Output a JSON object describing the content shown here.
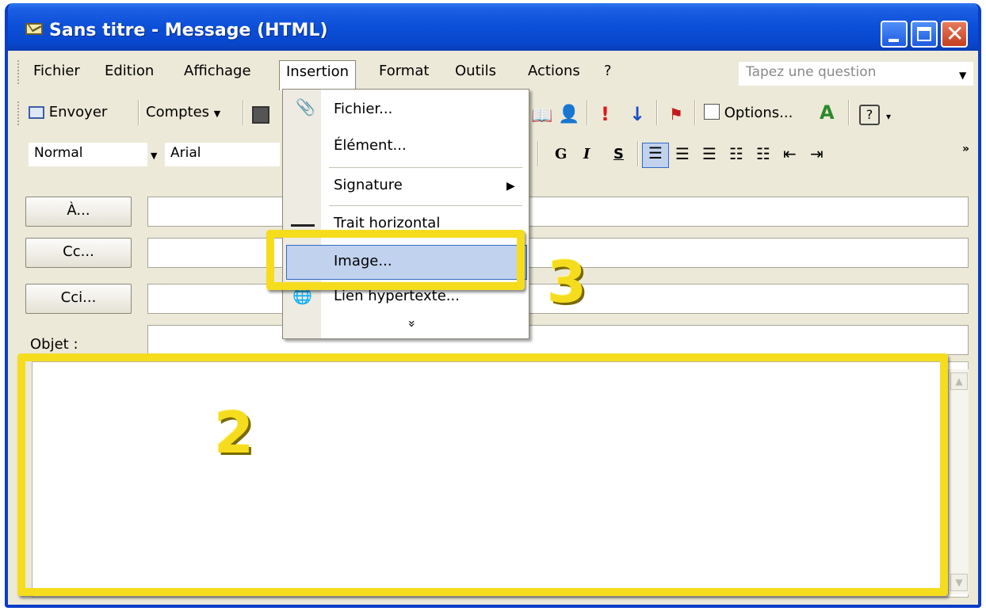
{
  "window": {
    "title": "Sans titre - Message (HTML)"
  },
  "menubar": {
    "items": [
      "Fichier",
      "Edition",
      "Affichage",
      "Insertion",
      "Format",
      "Outils",
      "Actions",
      "?"
    ],
    "active": "Insertion",
    "question_placeholder": "Tapez une question"
  },
  "toolbar": {
    "send_label": "Envoyer",
    "accounts_label": "Comptes",
    "options_label": "Options..."
  },
  "format_toolbar": {
    "style_value": "Normal",
    "font_value": "Arial",
    "bold": "G",
    "italic": "I",
    "underline": "S"
  },
  "header_fields": {
    "to_label": "À...",
    "cc_label": "Cc...",
    "bcc_label": "Cci...",
    "subject_label": "Objet :"
  },
  "insert_menu": {
    "items": [
      "Fichier...",
      "Élément...",
      "Signature",
      "Trait horizontal",
      "Image...",
      "Lien hypertexte..."
    ],
    "highlighted": "Image...",
    "more_glyph": "»"
  },
  "annotations": {
    "box_2": "2",
    "box_3": "3"
  },
  "colors": {
    "annotation_yellow": "#f5dd1e",
    "titlebar_blue": "#0b4fd8",
    "menu_highlight": "#c1d2ee"
  }
}
